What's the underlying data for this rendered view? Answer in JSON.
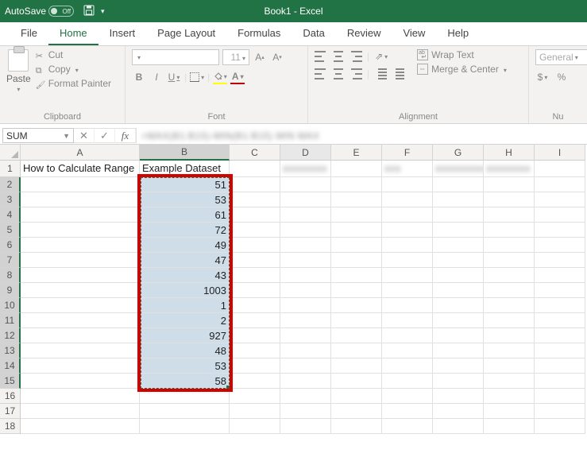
{
  "titlebar": {
    "autosave_label": "AutoSave",
    "autosave_state": "Off",
    "doc_title": "Book1 - Excel"
  },
  "tabs": [
    "File",
    "Home",
    "Insert",
    "Page Layout",
    "Formulas",
    "Data",
    "Review",
    "View",
    "Help"
  ],
  "active_tab": "Home",
  "ribbon": {
    "clipboard": {
      "paste": "Paste",
      "cut": "Cut",
      "copy": "Copy",
      "format_painter": "Format Painter",
      "group": "Clipboard"
    },
    "font": {
      "size": "11",
      "bold": "B",
      "italic": "I",
      "underline": "U",
      "group": "Font"
    },
    "alignment": {
      "wrap": "Wrap Text",
      "merge": "Merge & Center",
      "group": "Alignment"
    },
    "number": {
      "format": "General",
      "currency": "$",
      "percent": "%",
      "group": "Nu"
    }
  },
  "namebox": "SUM",
  "formula_blur": "=MAX(B1:B15)-MIN(B1:B15) MIN MAX",
  "columns": [
    "A",
    "B",
    "C",
    "D",
    "E",
    "F",
    "G",
    "H",
    "I"
  ],
  "rows": [
    1,
    2,
    3,
    4,
    5,
    6,
    7,
    8,
    9,
    10,
    11,
    12,
    13,
    14,
    15,
    16,
    17,
    18
  ],
  "cells": {
    "A1": "How to Calculate Range",
    "B1": "Example Dataset",
    "B2": "51",
    "B3": "53",
    "B4": "61",
    "B5": "72",
    "B6": "49",
    "B7": "47",
    "B8": "43",
    "B9": "1003",
    "B10": "1",
    "B11": "2",
    "B12": "927",
    "B13": "48",
    "B14": "53",
    "B15": "58"
  },
  "row1_blur": {
    "D1": "xxxxxxxx",
    "F1": "xxx",
    "G1": "xxxxxxxxx",
    "H1": "xxxxxxxx"
  }
}
